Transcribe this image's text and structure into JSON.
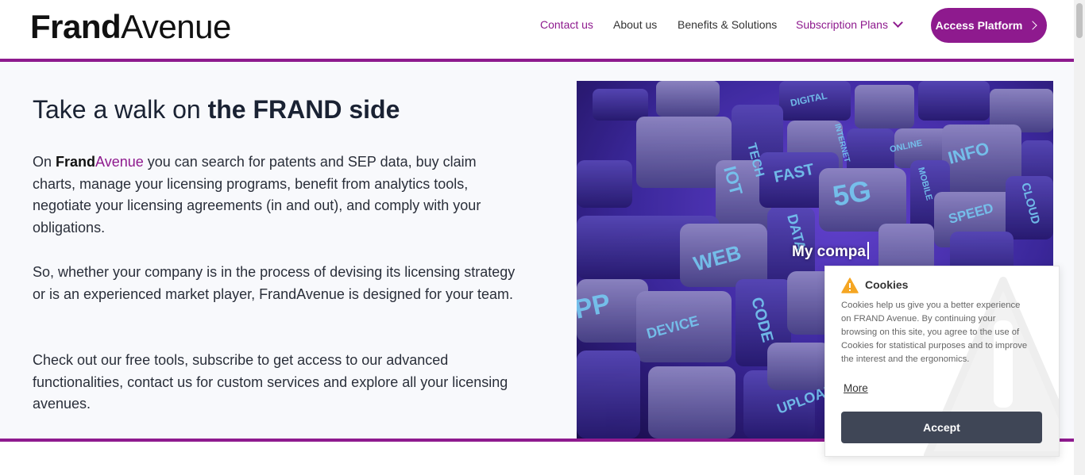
{
  "header": {
    "logo_bold": "Frand",
    "logo_light": "Avenue",
    "nav": {
      "contact": "Contact us",
      "about": "About us",
      "benefits": "Benefits & Solutions",
      "plans": "Subscription Plans"
    },
    "access_label": "Access Platform"
  },
  "hero": {
    "title_prefix": "Take a walk on ",
    "title_bold": "the FRAND side",
    "p1_lead": "On ",
    "p1_brand_bold": "Frand",
    "p1_brand_light": "Avenue",
    "p1_rest": " you can search for patents and SEP data, buy claim charts, manage your licensing programs, benefit from analytics tools, negotiate your licensing agreements (in and out), and comply with your obligations.",
    "p2": "So, whether your company is in the process of devising its licensing strategy or is an experienced market player, FrandAvenue is designed for your team.",
    "p3": "Check out our free tools, subscribe to get access to our advanced functionalities, contact us for custom services and explore all your licensing avenues."
  },
  "image": {
    "typing_text": "My compa",
    "keycaps": [
      "TECH",
      "DIGITAL",
      "FAST",
      "5G",
      "INFO",
      "ONLINE",
      "IOT",
      "DATA",
      "SPEED",
      "WEB",
      "DEVICE",
      "CODE",
      "INTERNET",
      "MOBILE",
      "CLOUD",
      "PP",
      "UPLOAD"
    ]
  },
  "cookie": {
    "title": "Cookies",
    "text": "Cookies help us give you a better experience on FRAND Avenue. By continuing your browsing on this site, you agree to the use of Cookies for statistical purposes and to improve the interest and the ergonomics.",
    "more": "More",
    "accept": "Accept"
  },
  "colors": {
    "brand_purple": "#8e1a8e",
    "button_dark": "#3f4656",
    "warning": "#f5a623"
  }
}
